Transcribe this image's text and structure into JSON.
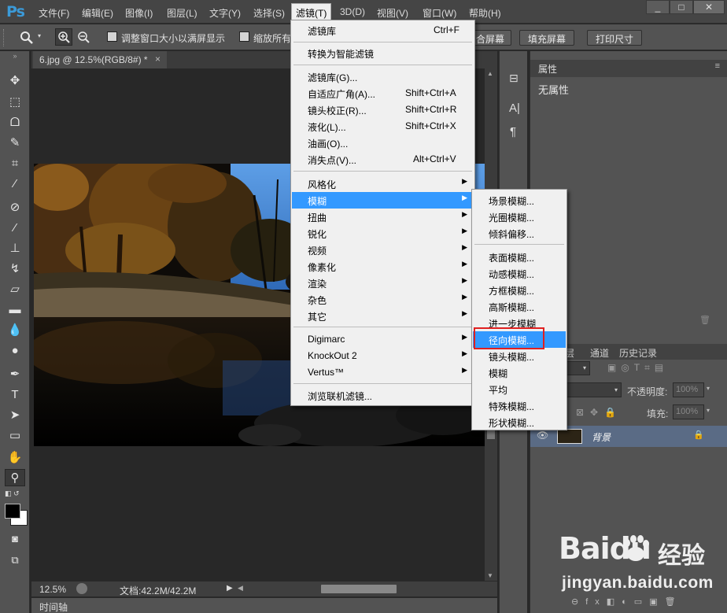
{
  "app": {
    "logo": "Ps"
  },
  "menubar": {
    "items": [
      "文件(F)",
      "编辑(E)",
      "图像(I)",
      "图层(L)",
      "文字(Y)",
      "选择(S)",
      "滤镜(T)",
      "3D(D)",
      "视图(V)",
      "窗口(W)",
      "帮助(H)"
    ],
    "active": "滤镜(T)"
  },
  "window_controls": {
    "minimize": "_",
    "restore": "□",
    "close": "✕"
  },
  "options": {
    "resize_windows_label": "调整窗口大小以满屏显示",
    "zoom_all_label": "缩放所有",
    "fit_screen_label": "合屏幕",
    "fill_screen_label": "填充屏幕",
    "print_size_label": "打印尺寸"
  },
  "document": {
    "tab_title": "6.jpg @ 12.5%(RGB/8#) *",
    "tab_close": "×",
    "zoom": "12.5%",
    "doc_info": "文档:42.2M/42.2M",
    "timeline_label": "时间轴"
  },
  "filter_menu": {
    "items": [
      {
        "label": "滤镜库",
        "shortcut": "Ctrl+F"
      },
      {
        "label": "转换为智能滤镜"
      },
      {
        "label": "滤镜库(G)..."
      },
      {
        "label": "自适应广角(A)...",
        "shortcut": "Shift+Ctrl+A"
      },
      {
        "label": "镜头校正(R)...",
        "shortcut": "Shift+Ctrl+R"
      },
      {
        "label": "液化(L)...",
        "shortcut": "Shift+Ctrl+X"
      },
      {
        "label": "油画(O)..."
      },
      {
        "label": "消失点(V)...",
        "shortcut": "Alt+Ctrl+V"
      },
      {
        "label": "风格化"
      },
      {
        "label": "模糊"
      },
      {
        "label": "扭曲"
      },
      {
        "label": "锐化"
      },
      {
        "label": "视频"
      },
      {
        "label": "像素化"
      },
      {
        "label": "渲染"
      },
      {
        "label": "杂色"
      },
      {
        "label": "其它"
      },
      {
        "label": "Digimarc"
      },
      {
        "label": "KnockOut 2"
      },
      {
        "label": "Vertus™"
      },
      {
        "label": "浏览联机滤镜..."
      }
    ],
    "highlighted": "模糊"
  },
  "blur_submenu": {
    "items": [
      "场景模糊...",
      "光圈模糊...",
      "倾斜偏移...",
      "表面模糊...",
      "动感模糊...",
      "方框模糊...",
      "高斯模糊...",
      "进一步模糊",
      "径向模糊...",
      "镜头模糊...",
      "模糊",
      "平均",
      "特殊模糊...",
      "形状模糊..."
    ],
    "highlighted": "径向模糊..."
  },
  "properties_panel": {
    "title": "属性",
    "content": "无属性"
  },
  "layers_panel": {
    "tabs": [
      "层",
      "通道",
      "历史记录"
    ],
    "opacity_label": "不透明度:",
    "opacity_value": "100%",
    "fill_label": "填充:",
    "fill_value": "100%",
    "layer_name": "背景"
  },
  "watermark": {
    "brand": "Baidu",
    "cn": "经验",
    "url": "jingyan.baidu.com"
  },
  "colors": {
    "highlight": "#3399ff",
    "annotation": "#e02020",
    "ps_logo": "#3b9ad8"
  }
}
